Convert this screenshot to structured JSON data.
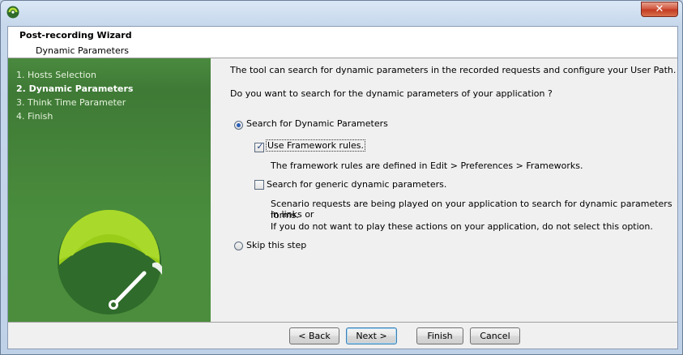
{
  "window": {
    "close_glyph": "✕"
  },
  "header": {
    "title": "Post-recording Wizard",
    "subtitle": "Dynamic Parameters"
  },
  "sidebar": {
    "items": [
      {
        "label": "1. Hosts Selection",
        "active": false
      },
      {
        "label": "2. Dynamic Parameters",
        "active": true
      },
      {
        "label": "3. Think Time Parameter",
        "active": false
      },
      {
        "label": "4. Finish",
        "active": false
      }
    ]
  },
  "content": {
    "intro": "The tool can search for dynamic parameters in the recorded requests and configure your User Path.",
    "question": "Do you want to search for the dynamic parameters of your application ?",
    "radio_search": {
      "label": "Search for Dynamic Parameters",
      "selected": true
    },
    "check_framework": {
      "label": "Use Framework rules.",
      "checked": true
    },
    "framework_note": "The framework rules are defined in Edit > Preferences > Frameworks.",
    "check_generic": {
      "label": "Search for generic dynamic parameters.",
      "checked": false
    },
    "generic_note_1": "Scenario requests are being played on your application to search for dynamic parameters in links or",
    "generic_note_2": "forms.",
    "generic_note_3": "If you do not want to play these actions on your application, do not select this option.",
    "radio_skip": {
      "label": "Skip this step",
      "selected": false
    }
  },
  "buttons": {
    "back": "< Back",
    "next": "Next >",
    "finish": "Finish",
    "cancel": "Cancel"
  },
  "colors": {
    "sidebar_green": "#4a8d3d",
    "gauge_light": "#9acd1a",
    "accent_blue": "#3c7fb1"
  }
}
